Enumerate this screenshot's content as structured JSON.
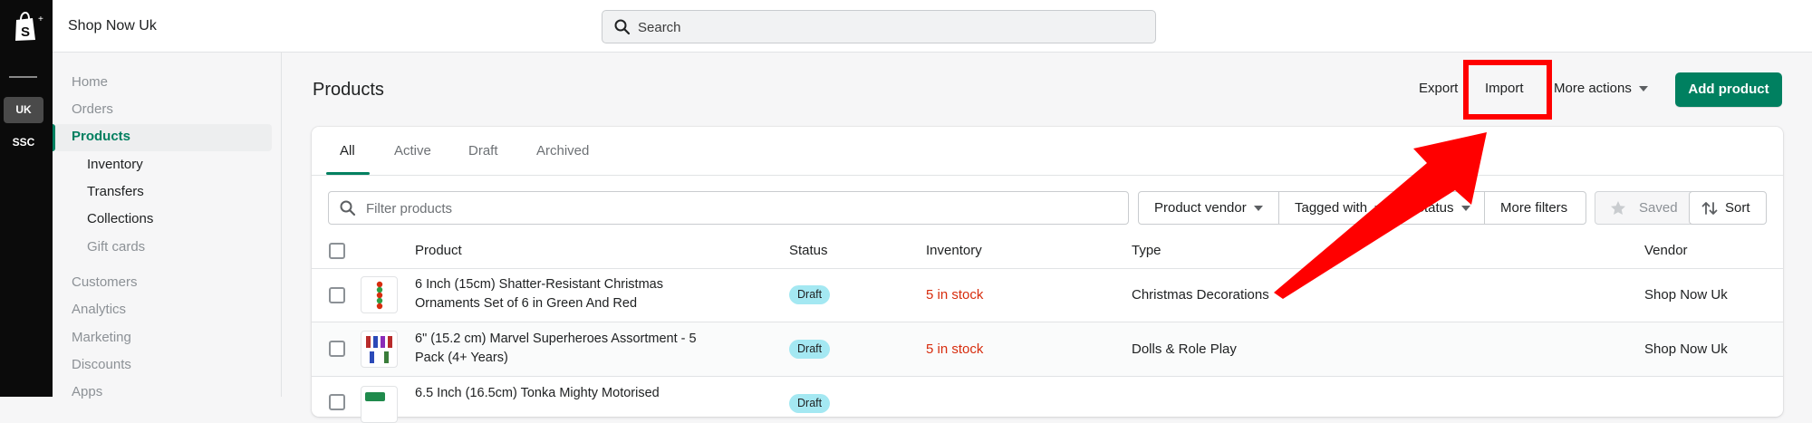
{
  "topbar": {
    "shop_name": "Shop Now Uk",
    "search_placeholder": "Search"
  },
  "rail": {
    "stores": [
      "UK",
      "SSC"
    ]
  },
  "sidebar": {
    "items": [
      {
        "label": "Home"
      },
      {
        "label": "Orders"
      },
      {
        "label": "Products"
      },
      {
        "label": "Inventory"
      },
      {
        "label": "Transfers"
      },
      {
        "label": "Collections"
      },
      {
        "label": "Gift cards"
      },
      {
        "label": "Customers"
      },
      {
        "label": "Analytics"
      },
      {
        "label": "Marketing"
      },
      {
        "label": "Discounts"
      },
      {
        "label": "Apps"
      }
    ]
  },
  "header": {
    "title": "Products",
    "export_label": "Export",
    "import_label": "Import",
    "more_actions_label": "More actions",
    "add_product_label": "Add product"
  },
  "tabs": [
    "All",
    "Active",
    "Draft",
    "Archived"
  ],
  "filters": {
    "placeholder": "Filter products",
    "product_vendor": "Product vendor",
    "tagged_with": "Tagged with",
    "status": "Status",
    "more_filters": "More filters",
    "saved": "Saved",
    "sort": "Sort"
  },
  "table": {
    "columns": [
      "Product",
      "Status",
      "Inventory",
      "Type",
      "Vendor"
    ],
    "rows": [
      {
        "name": "6 Inch (15cm) Shatter-Resistant Christmas Ornaments Set of 6 in Green And Red",
        "status": "Draft",
        "inventory": "5 in stock",
        "type": "Christmas Decorations",
        "vendor": "Shop Now Uk"
      },
      {
        "name": "6\" (15.2 cm) Marvel Superheroes Assortment - 5 Pack (4+ Years)",
        "status": "Draft",
        "inventory": "5 in stock",
        "type": "Dolls & Role Play",
        "vendor": "Shop Now Uk"
      },
      {
        "name": "6.5 Inch (16.5cm) Tonka Mighty Motorised",
        "status": "Draft",
        "inventory": "",
        "type": "",
        "vendor": ""
      }
    ]
  },
  "colors": {
    "accent": "#008060",
    "highlight": "#ff0000",
    "danger": "#d72c0d",
    "badge": "#a4e8f2"
  }
}
